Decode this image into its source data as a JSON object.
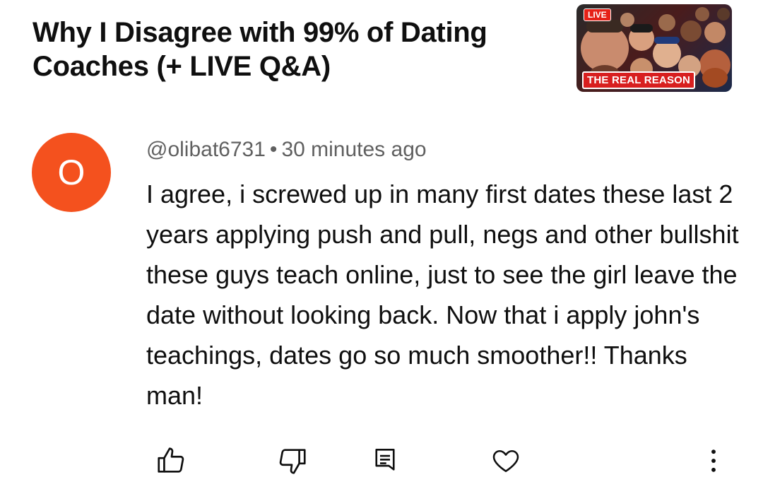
{
  "video": {
    "title": "Why I Disagree with 99% of Dating Coaches (+ LIVE Q&A)",
    "thumbnail": {
      "badge": "LIVE",
      "caption": "THE REAL REASON"
    }
  },
  "comment": {
    "avatar_letter": "O",
    "avatar_color": "#f4511e",
    "author": "@olibat6731",
    "separator": "•",
    "time": "30 minutes ago",
    "text": "I agree, i screwed up in many first dates these last 2 years applying push and pull, negs and other bullshit these guys teach online, just to see the girl leave the date without looking back. Now that i apply john's teachings, dates go so much smoother!! Thanks man!"
  },
  "actions": [
    {
      "icon": "thumbs-up-icon"
    },
    {
      "icon": "thumbs-down-icon"
    },
    {
      "icon": "reply-icon"
    },
    {
      "icon": "heart-icon"
    },
    {
      "icon": "more-vertical-icon"
    }
  ]
}
